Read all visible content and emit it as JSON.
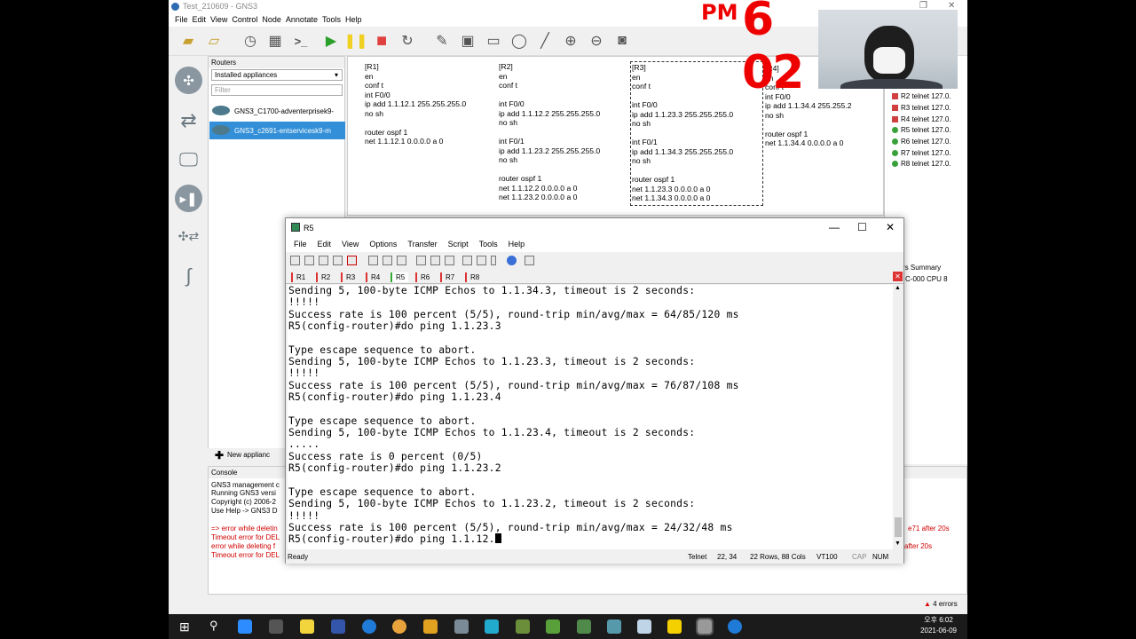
{
  "gns3": {
    "window_title": "Test_210609 - GNS3",
    "menu": [
      "File",
      "Edit",
      "View",
      "Control",
      "Node",
      "Annotate",
      "Tools",
      "Help"
    ],
    "routers_panel": {
      "title": "Routers",
      "filter_dropdown": "Installed appliances",
      "filter_placeholder": "Filter",
      "appliances": [
        "GNS3_C1700-adventerprisek9-",
        "GNS3_c2691-entservicesk9-m"
      ],
      "new_appliance_label": "New applianc"
    },
    "canvas_notes": {
      "r1": "[R1]\nen\nconf t\nint F0/0\nip add 1.1.12.1 255.255.255.0\nno sh\n\nrouter ospf 1\nnet 1.1.12.1 0.0.0.0 a 0",
      "r2": "[R2]\nen\nconf t\n\nint F0/0\nip add 1.1.12.2 255.255.255.0\nno sh\n\nint F0/1\nip add 1.1.23.2 255.255.255.0\nno sh\n\nrouter ospf 1\nnet 1.1.12.2 0.0.0.0 a 0\nnet 1.1.23.2 0.0.0.0 a 0",
      "r3": "[R3]\nen\nconf t\n\nint F0/0\nip add 1.1.23.3 255.255.255.0\nno sh\n\nint F0/1\nip add 1.1.34.3 255.255.255.0\nno sh\n\nrouter ospf 1\nnet 1.1.23.3 0.0.0.0 a 0\nnet 1.1.34.3 0.0.0.0 a 0",
      "r4": "[R4]\nen\nconf t\nint F0/0\nip add 1.1.34.4 255.255.2\nno sh\n\nrouter ospf 1\nnet 1.1.34.4 0.0.0.0 a 0"
    },
    "topology_summary": [
      {
        "label": "R2 telnet 127.0.",
        "color": "#d04040"
      },
      {
        "label": "R3 telnet 127.0.",
        "color": "#d04040"
      },
      {
        "label": "R4 telnet 127.0.",
        "color": "#d04040"
      },
      {
        "label": "R5 telnet 127.0.",
        "color": "#3aa03a"
      },
      {
        "label": "R6 telnet 127.0.",
        "color": "#3aa03a"
      },
      {
        "label": "R7 telnet 127.0.",
        "color": "#3aa03a"
      },
      {
        "label": "R8 telnet 127.0.",
        "color": "#3aa03a"
      }
    ],
    "servers_summary_title": "rs Summary",
    "servers_summary_item": "C-000 CPU 8",
    "console": {
      "title": "Console",
      "lines": [
        "GNS3 management c",
        "Running GNS3 versi",
        "Copyright (c) 2006-2",
        "Use Help -> GNS3 D"
      ],
      "errors": [
        "=> error while deletin",
        "Timeout error for DEL",
        "error while deleting f",
        "Timeout error for DEL"
      ],
      "right_errors": [
        "e71 after 20s",
        "after 20s"
      ]
    },
    "error_count": "4 errors"
  },
  "clock_overlay": {
    "pm": "PM",
    "time": "6 02"
  },
  "r5": {
    "window_title": "R5",
    "menu": [
      "File",
      "Edit",
      "View",
      "Options",
      "Transfer",
      "Script",
      "Tools",
      "Help"
    ],
    "tabs": [
      "R1",
      "R2",
      "R3",
      "R4",
      "R5",
      "R6",
      "R7",
      "R8"
    ],
    "terminal": "Sending 5, 100-byte ICMP Echos to 1.1.34.3, timeout is 2 seconds:\n!!!!!\nSuccess rate is 100 percent (5/5), round-trip min/avg/max = 64/85/120 ms\nR5(config-router)#do ping 1.1.23.3\n\nType escape sequence to abort.\nSending 5, 100-byte ICMP Echos to 1.1.23.3, timeout is 2 seconds:\n!!!!!\nSuccess rate is 100 percent (5/5), round-trip min/avg/max = 76/87/108 ms\nR5(config-router)#do ping 1.1.23.4\n\nType escape sequence to abort.\nSending 5, 100-byte ICMP Echos to 1.1.23.4, timeout is 2 seconds:\n.....\nSuccess rate is 0 percent (0/5)\nR5(config-router)#do ping 1.1.23.2\n\nType escape sequence to abort.\nSending 5, 100-byte ICMP Echos to 1.1.23.2, timeout is 2 seconds:\n!!!!!\nSuccess rate is 100 percent (5/5), round-trip min/avg/max = 24/32/48 ms\nR5(config-router)#do ping 1.1.12.",
    "status": {
      "ready": "Ready",
      "protocol": "Telnet",
      "position": "22,  34",
      "size": "22 Rows,  88 Cols",
      "emulation": "VT100",
      "caps": "CAP",
      "num": "NUM"
    }
  },
  "taskbar": {
    "time": "오후 6:02",
    "date": "2021-06-09"
  }
}
